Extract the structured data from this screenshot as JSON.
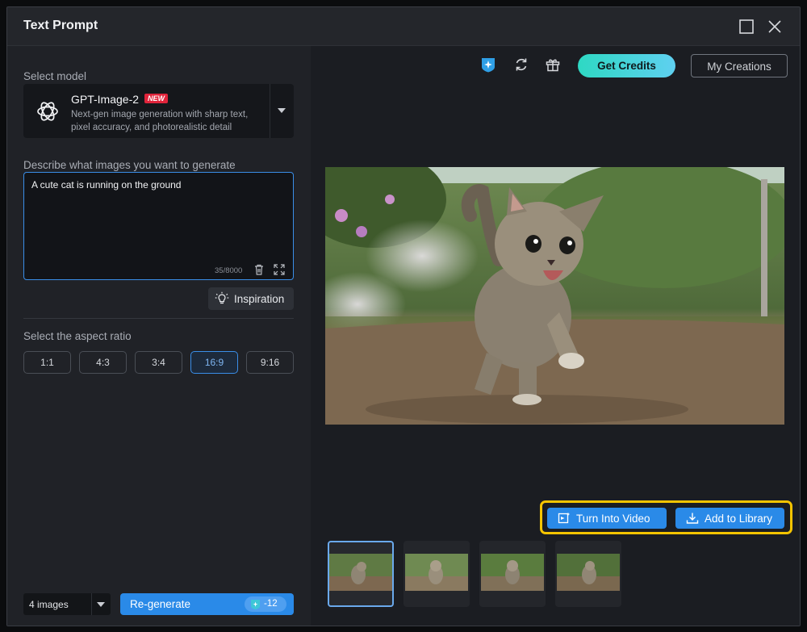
{
  "window": {
    "title": "Text Prompt"
  },
  "left": {
    "model_label": "Select model",
    "model": {
      "name": "GPT-Image-2",
      "badge": "NEW",
      "description": "Next-gen image generation with sharp text, pixel accuracy, and photorealistic detail"
    },
    "prompt_label": "Describe what images you want to generate",
    "prompt": {
      "value": "A cute cat is running on the ground",
      "char_count": "35/8000"
    },
    "inspiration_label": "Inspiration",
    "aspect_label": "Select the aspect ratio",
    "aspect_ratios": [
      "1:1",
      "4:3",
      "3:4",
      "16:9",
      "9:16"
    ],
    "aspect_selected": "16:9",
    "image_count": "4 images",
    "regenerate_label": "Re-generate",
    "regenerate_cost": "-12"
  },
  "right": {
    "get_credits_label": "Get Credits",
    "my_creations_label": "My Creations",
    "turn_into_video_label": "Turn Into Video",
    "add_to_library_label": "Add to Library",
    "thumbnail_count": 4,
    "selected_thumbnail": 1
  },
  "colors": {
    "accent": "#2a8ae8",
    "highlight": "#f5c400",
    "badge_new": "#e0243b",
    "credits_gradient": [
      "#2ed8c3",
      "#5fd0f0"
    ]
  },
  "icons": [
    "maximize-icon",
    "close-icon",
    "openai-logo-icon",
    "chevron-down-icon",
    "trash-icon",
    "expand-icon",
    "lightbulb-icon",
    "credit-icon",
    "refresh-icon",
    "gift-icon",
    "video-icon",
    "download-icon"
  ]
}
